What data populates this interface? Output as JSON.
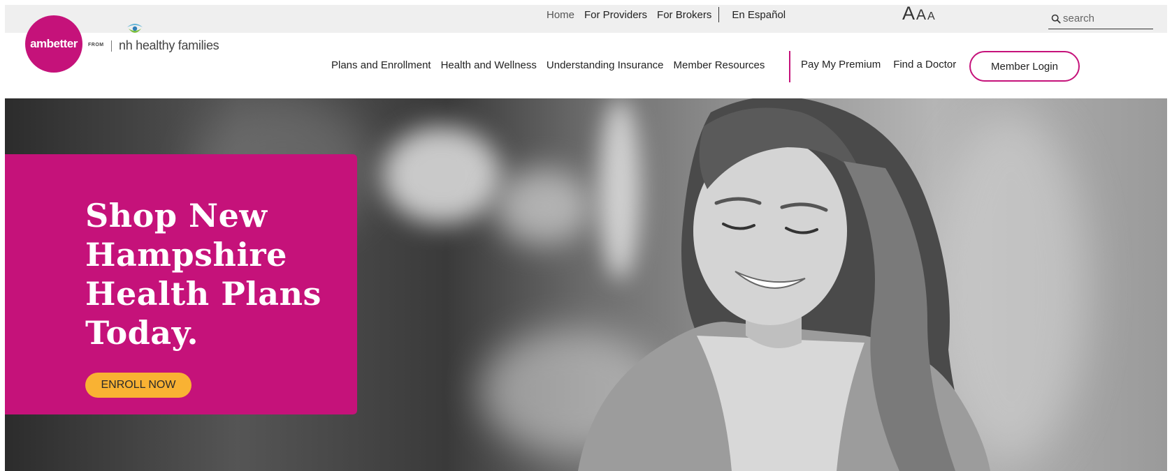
{
  "utility_nav": {
    "links": [
      "Home",
      "For Providers",
      "For Brokers"
    ],
    "language_link": "En Español",
    "font_size_labels": [
      "A",
      "A",
      "A"
    ]
  },
  "search": {
    "placeholder": "search"
  },
  "logo": {
    "brand": "ambetter",
    "from_label": "FROM",
    "partner": "nh healthy families"
  },
  "main_nav": {
    "items": [
      "Plans and Enrollment",
      "Health and Wellness",
      "Understanding Insurance",
      "Member Resources"
    ],
    "quick_links": [
      "Pay My Premium",
      "Find a Doctor"
    ],
    "login_label": "Member Login"
  },
  "hero": {
    "title": "Shop New Hampshire Health Plans Today.",
    "cta_label": "ENROLL NOW"
  },
  "colors": {
    "brand_magenta": "#c5127a",
    "cta_yellow": "#f9b233",
    "utility_bar_bg": "#efefef"
  },
  "icons": [
    "search-icon",
    "nh-healthy-families-logo-icon"
  ]
}
